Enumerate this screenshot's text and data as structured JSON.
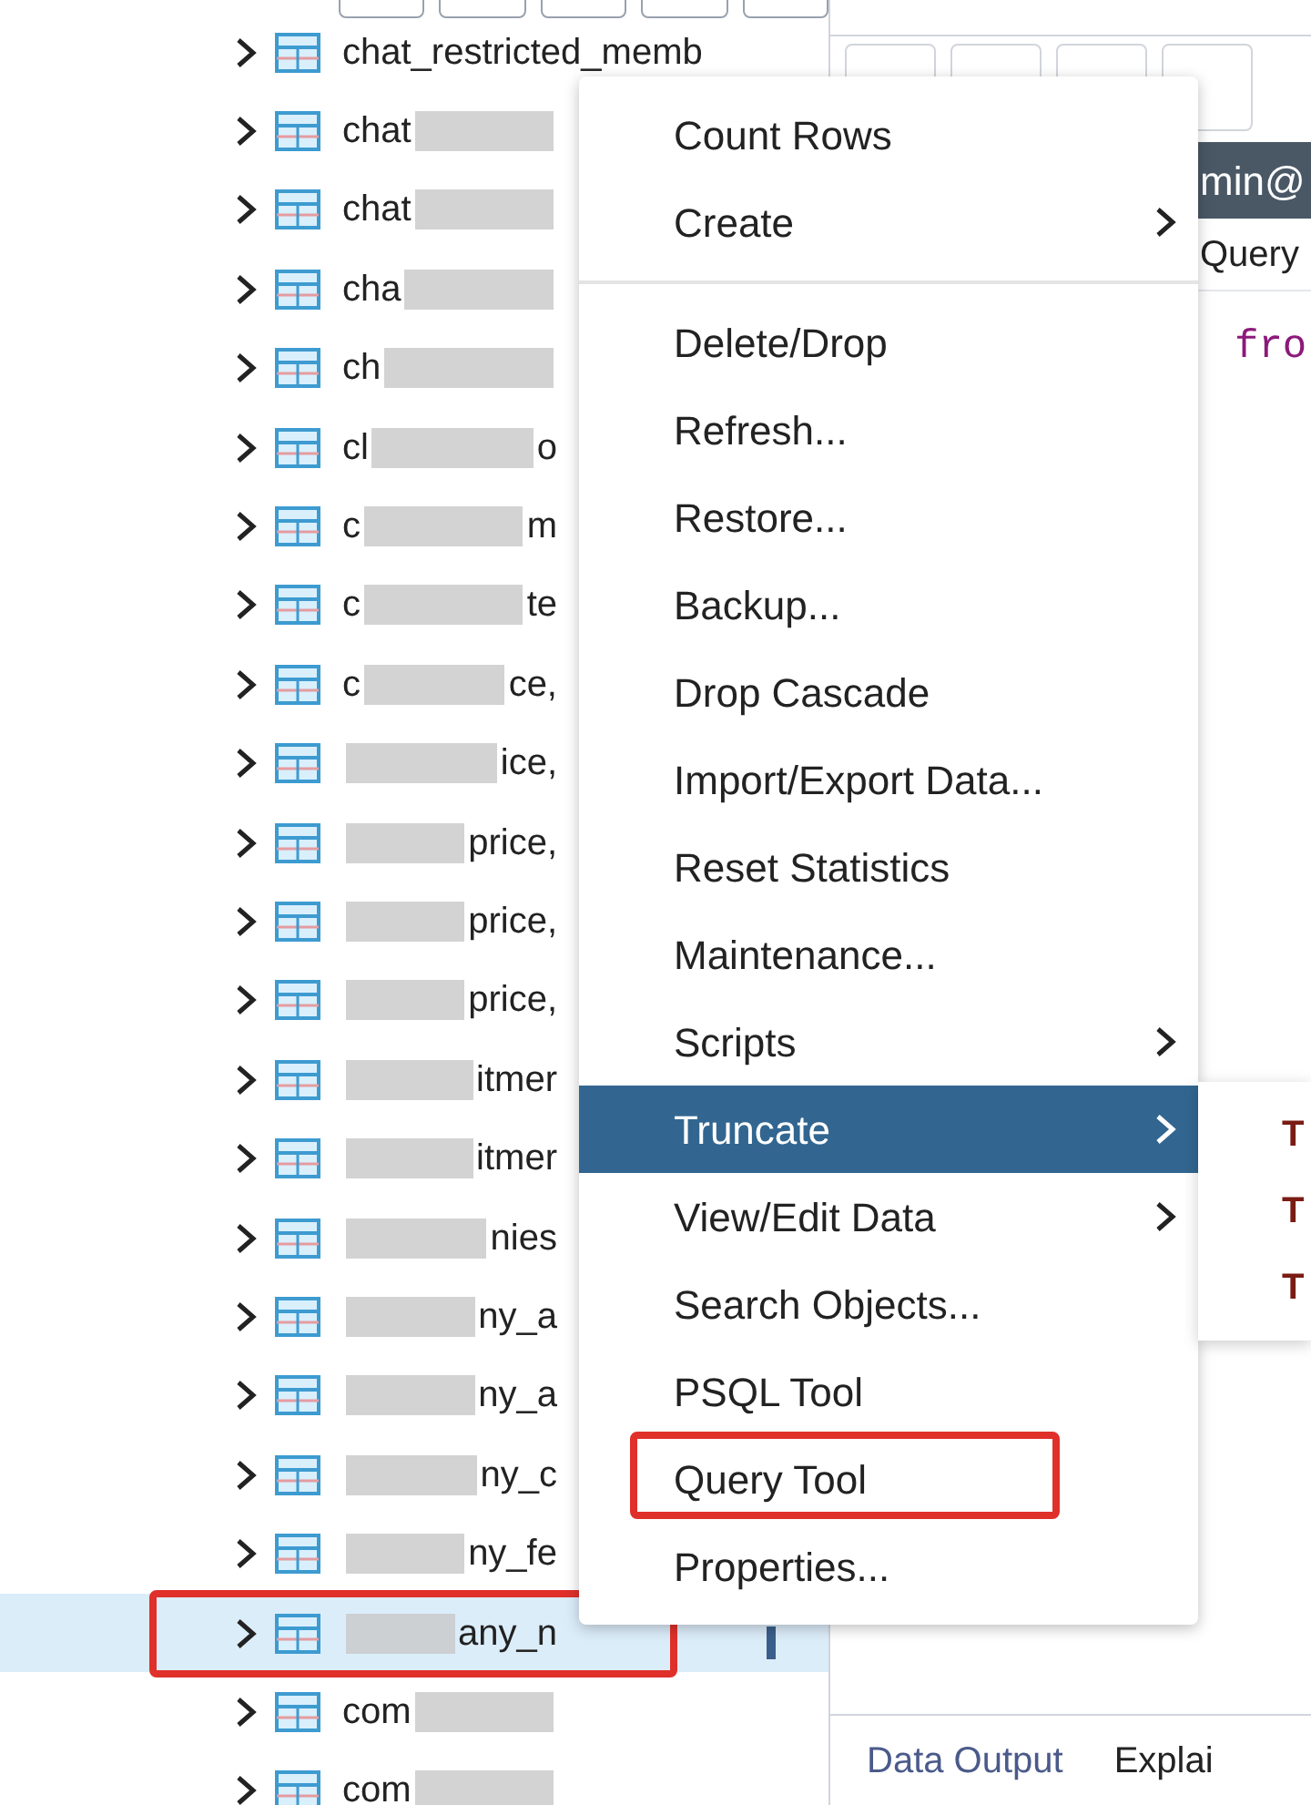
{
  "tree": {
    "items": [
      {
        "label": "chat_restricted_memb",
        "redacted": false,
        "selected": false,
        "marked": false
      },
      {
        "label": "chat",
        "redacted": true,
        "selected": false,
        "marked": false
      },
      {
        "label": "chat",
        "redacted": true,
        "selected": false,
        "marked": false
      },
      {
        "label": "cha",
        "redacted": true,
        "selected": false,
        "marked": false
      },
      {
        "label": "ch",
        "redacted": true,
        "selected": false,
        "marked": false
      },
      {
        "label": "cl",
        "tail": "o",
        "redacted": true,
        "selected": false,
        "marked": false
      },
      {
        "label": "c",
        "tail": "m",
        "redacted": true,
        "selected": false,
        "marked": false
      },
      {
        "label": "c",
        "tail": "te",
        "redacted": true,
        "selected": false,
        "marked": false
      },
      {
        "label": "c",
        "tail": "ce,",
        "redacted": true,
        "selected": false,
        "marked": false
      },
      {
        "tail": "ice,",
        "redacted": true,
        "selected": false,
        "marked": false
      },
      {
        "tail": "price,",
        "redacted": true,
        "selected": false,
        "marked": false
      },
      {
        "tail": "price,",
        "redacted": true,
        "selected": false,
        "marked": false
      },
      {
        "tail": "price,",
        "redacted": true,
        "selected": false,
        "marked": false
      },
      {
        "tail": "itmer",
        "redacted": true,
        "selected": false,
        "marked": false
      },
      {
        "tail": "itmer",
        "redacted": true,
        "selected": false,
        "marked": false
      },
      {
        "tail": "nies",
        "redacted": true,
        "selected": false,
        "marked": false
      },
      {
        "tail": "ny_a",
        "redacted": true,
        "selected": false,
        "marked": false
      },
      {
        "tail": "ny_a",
        "redacted": true,
        "selected": false,
        "marked": false
      },
      {
        "tail": "ny_c",
        "redacted": true,
        "selected": false,
        "marked": false
      },
      {
        "tail": "ny_fe",
        "redacted": true,
        "selected": false,
        "marked": false
      },
      {
        "tail": "any_n",
        "redacted": true,
        "selected": true,
        "marked": true
      },
      {
        "label": "com",
        "redacted": true,
        "selected": false,
        "marked": false
      },
      {
        "label": "com",
        "redacted": true,
        "selected": false,
        "marked": false
      }
    ]
  },
  "query_panel": {
    "connection": "min@",
    "tab": "Query",
    "code": "fro",
    "result_tabs": [
      "Data Output",
      "Explai"
    ]
  },
  "context_menu": {
    "groups": [
      [
        {
          "label": "Count Rows",
          "submenu": false,
          "selected": false,
          "marked": false
        },
        {
          "label": "Create",
          "submenu": true,
          "selected": false,
          "marked": false
        }
      ],
      [
        {
          "label": "Delete/Drop",
          "submenu": false,
          "selected": false,
          "marked": false
        },
        {
          "label": "Refresh...",
          "submenu": false,
          "selected": false,
          "marked": false
        },
        {
          "label": "Restore...",
          "submenu": false,
          "selected": false,
          "marked": false
        },
        {
          "label": "Backup...",
          "submenu": false,
          "selected": false,
          "marked": false
        },
        {
          "label": "Drop Cascade",
          "submenu": false,
          "selected": false,
          "marked": false
        },
        {
          "label": "Import/Export Data...",
          "submenu": false,
          "selected": false,
          "marked": false
        },
        {
          "label": "Reset Statistics",
          "submenu": false,
          "selected": false,
          "marked": false
        },
        {
          "label": "Maintenance...",
          "submenu": false,
          "selected": false,
          "marked": false
        },
        {
          "label": "Scripts",
          "submenu": true,
          "selected": false,
          "marked": false
        },
        {
          "label": "Truncate",
          "submenu": true,
          "selected": true,
          "marked": false
        },
        {
          "label": "View/Edit Data",
          "submenu": true,
          "selected": false,
          "marked": false
        },
        {
          "label": "Search Objects...",
          "submenu": false,
          "selected": false,
          "marked": false
        },
        {
          "label": "PSQL Tool",
          "submenu": false,
          "selected": false,
          "marked": false
        },
        {
          "label": "Query Tool",
          "submenu": false,
          "selected": false,
          "marked": true
        },
        {
          "label": "Properties...",
          "submenu": false,
          "selected": false,
          "marked": false
        }
      ]
    ],
    "submenu": [
      "T",
      "T",
      "T"
    ]
  }
}
